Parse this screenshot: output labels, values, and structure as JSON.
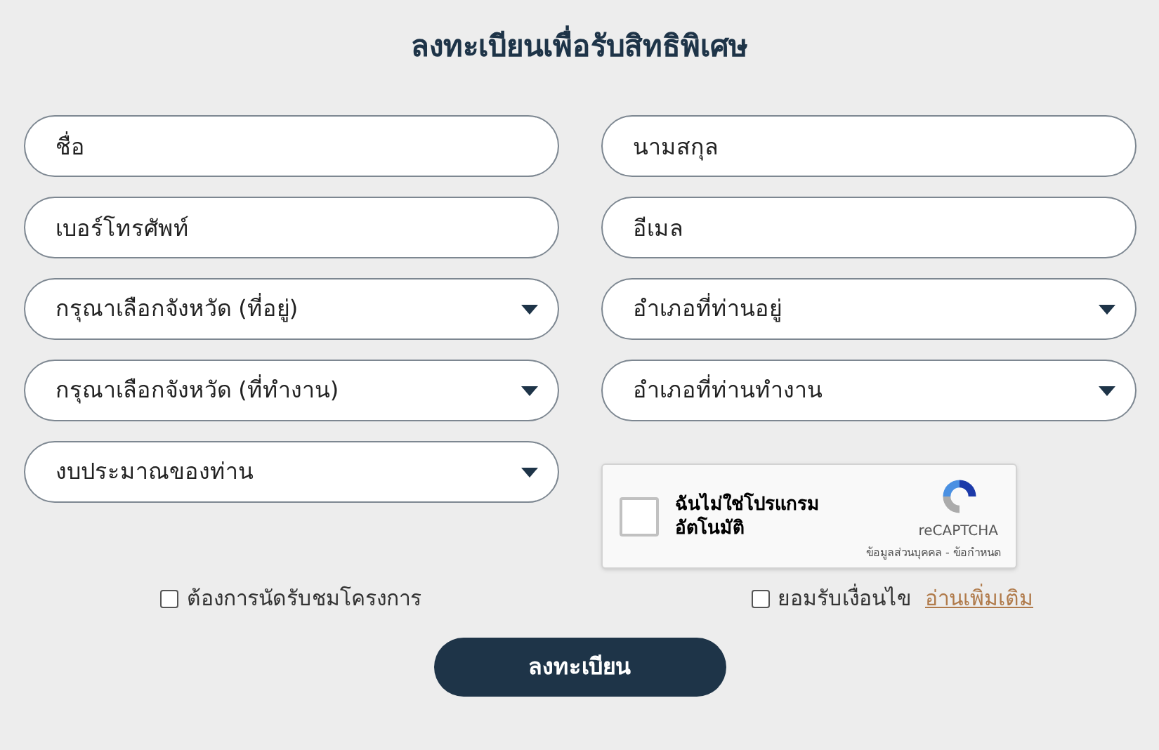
{
  "title": "ลงทะเบียนเพื่อรับสิทธิพิเศษ",
  "fields": [
    {
      "kind": "text",
      "placeholder": "ชื่อ"
    },
    {
      "kind": "text",
      "placeholder": "นามสกุล"
    },
    {
      "kind": "text",
      "placeholder": "เบอร์โทรศัพท์"
    },
    {
      "kind": "text",
      "placeholder": "อีเมล"
    },
    {
      "kind": "select",
      "value": "กรุณาเลือกจังหวัด (ที่อยู่)"
    },
    {
      "kind": "select",
      "value": "อำเภอที่ท่านอยู่"
    },
    {
      "kind": "select",
      "value": "กรุณาเลือกจังหวัด (ที่ทำงาน)"
    },
    {
      "kind": "select",
      "value": "อำเภอที่ท่านทำงาน"
    },
    {
      "kind": "select",
      "value": "งบประมาณของท่าน"
    }
  ],
  "captcha": {
    "checked": false,
    "label_lines": [
      "ฉันไม่ใช่โปรแกรม",
      "อัตโนมัติ"
    ],
    "brand": "reCAPTCHA",
    "links": "ข้อมูลส่วนบุคคล - ข้อกำหนด"
  },
  "options": [
    {
      "label": "ต้องการนัดรับชมโครงการ",
      "checked": false
    },
    {
      "label": "ยอมรับเงื่อนไข",
      "checked": false,
      "link": "อ่านเพิ่มเติม"
    }
  ],
  "submit": "ลงทะเบียน"
}
